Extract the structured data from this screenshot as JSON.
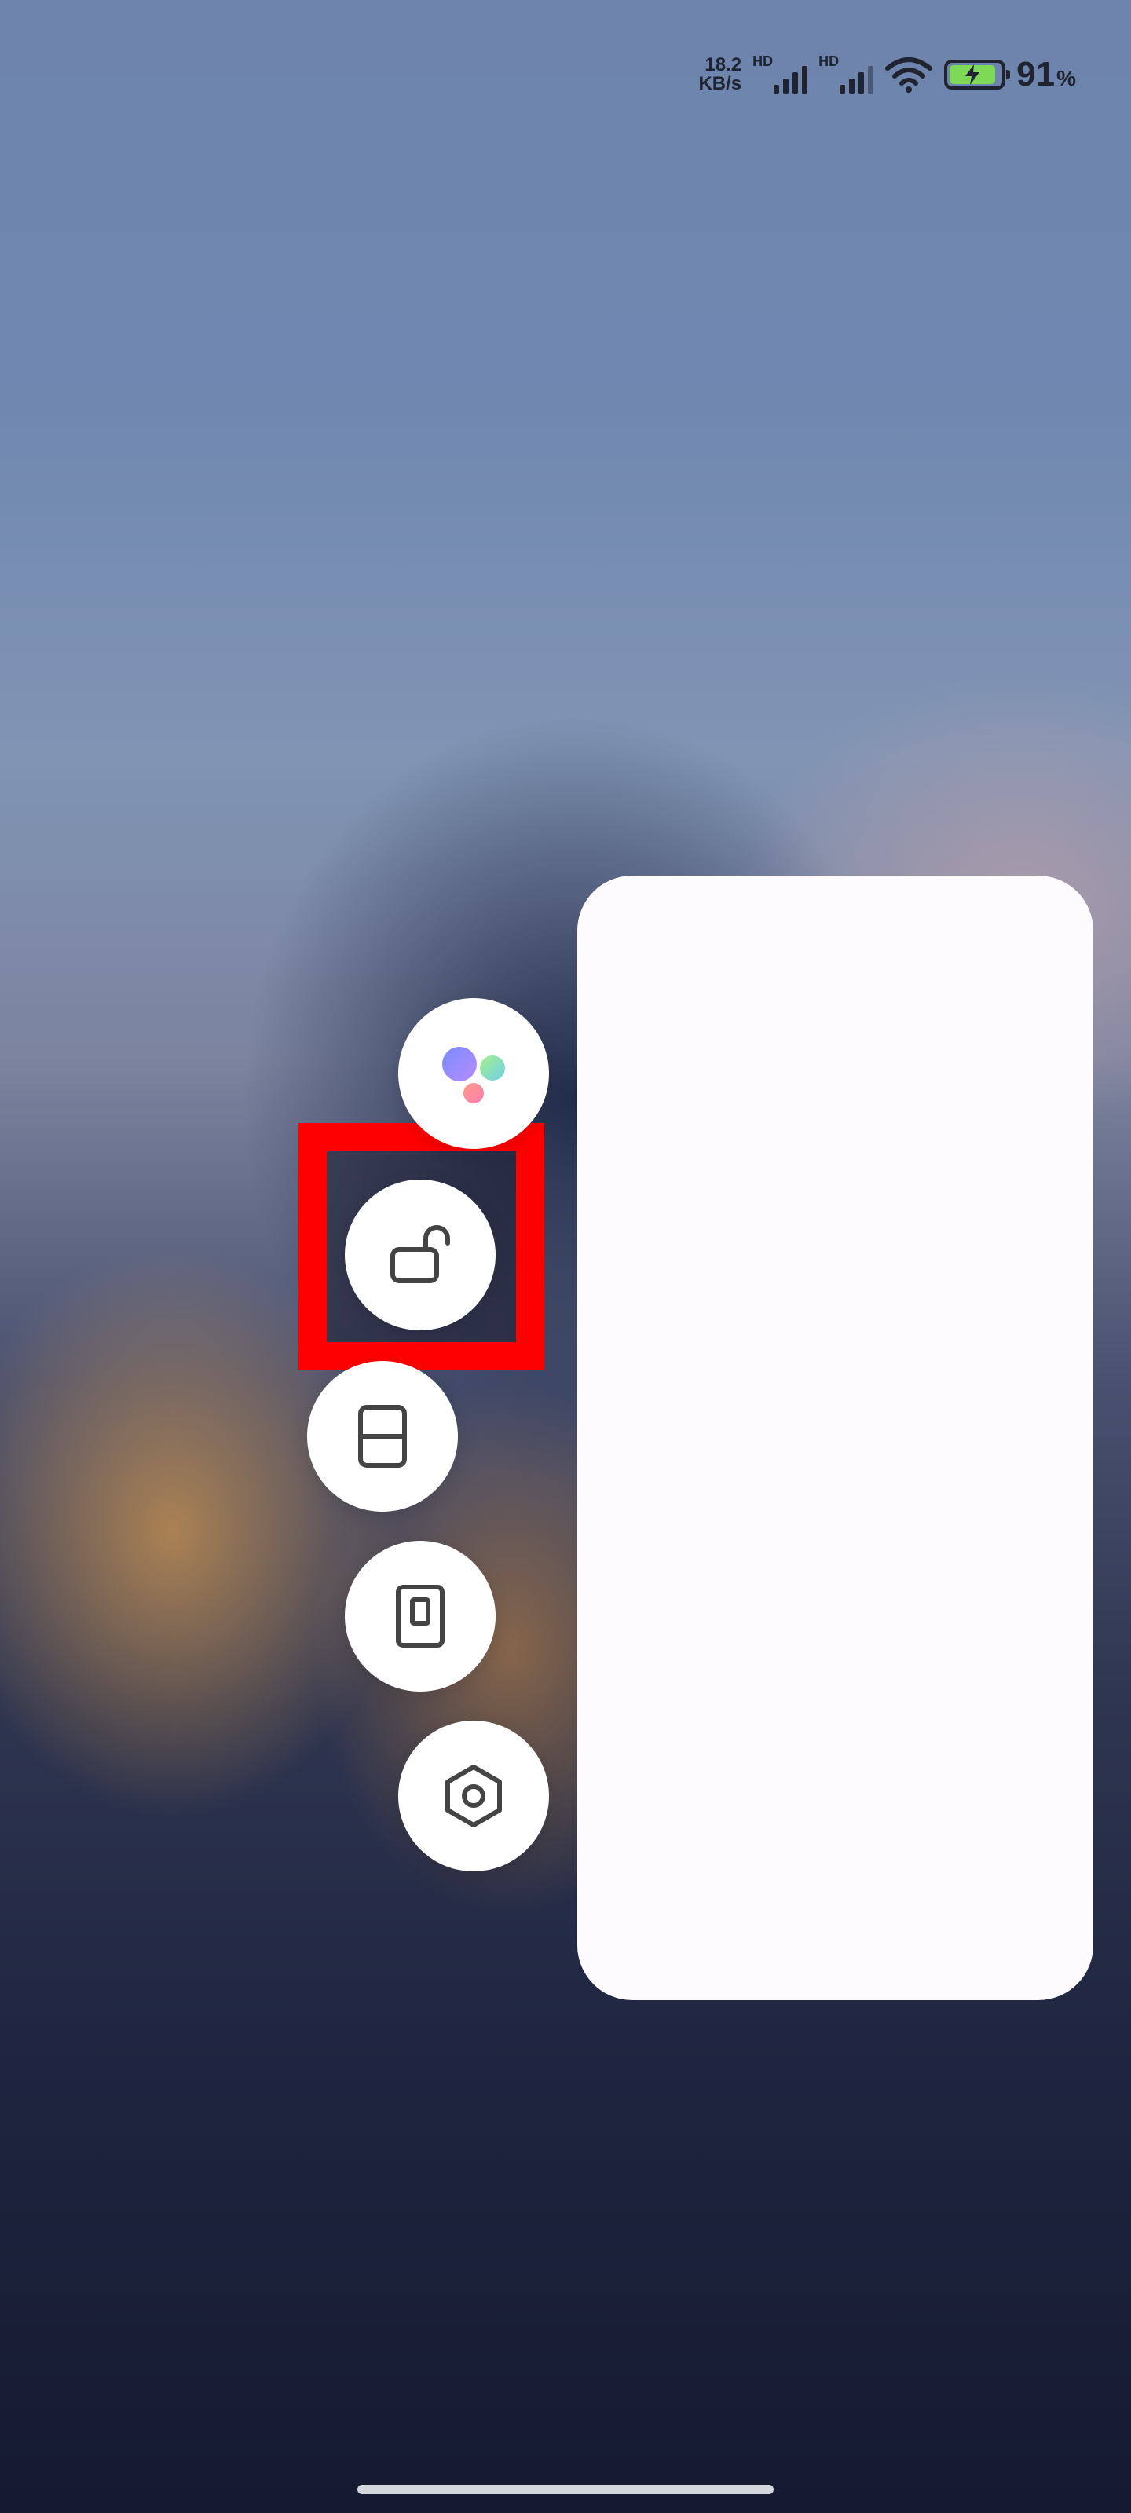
{
  "status_bar": {
    "net_speed_value": "18.2",
    "net_speed_unit": "KB/s",
    "sim1_label": "HD",
    "sim2_label": "HD",
    "battery_value": "91",
    "battery_unit": "%",
    "battery_level": 0.91,
    "battery_color": "#7ed957"
  },
  "quick_actions": [
    {
      "icon": "assistant-dots-icon"
    },
    {
      "icon": "unlock-icon"
    },
    {
      "icon": "split-screen-icon"
    },
    {
      "icon": "floating-window-icon"
    },
    {
      "icon": "settings-hexagon-icon"
    }
  ],
  "highlight_color": "#ff0000",
  "panel_color": "#fdfbfd"
}
